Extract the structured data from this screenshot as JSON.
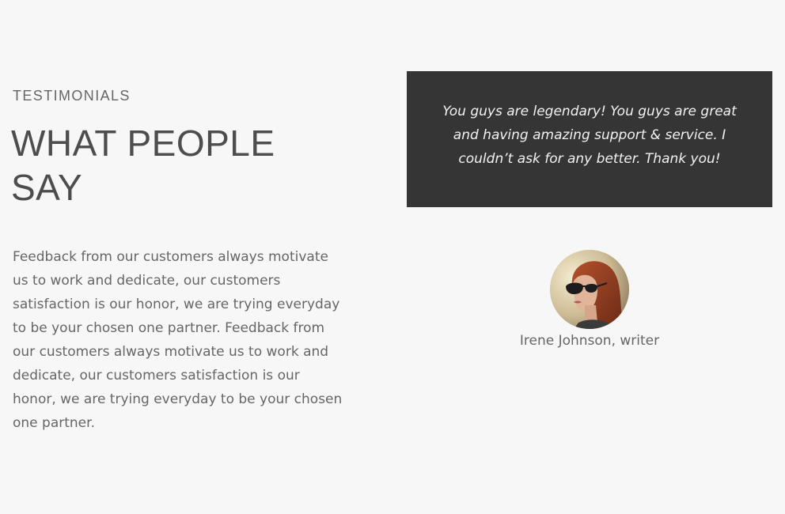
{
  "section": {
    "label": "TESTIMONIALS",
    "title": "WHAT PEOPLE SAY",
    "body": "Feedback from our customers always motivate us to work and dedicate, our customers satisfaction is our honor, we are trying everyday to be your chosen one partner. Feedback from our customers always motivate us to work and dedicate, our customers satisfaction is our honor, we are trying everyday to be your chosen one partner."
  },
  "testimonial": {
    "quote": "You guys are legendary! You guys are great and having amazing support & service. I couldn’t ask for any better. Thank you!",
    "author": "Irene Johnson, writer",
    "avatar_icon": "woman-with-sunglasses-photo"
  },
  "colors": {
    "background": "#f7f7f7",
    "quote_box": "#353535",
    "heading": "#4d4d4d",
    "text": "#666666"
  }
}
